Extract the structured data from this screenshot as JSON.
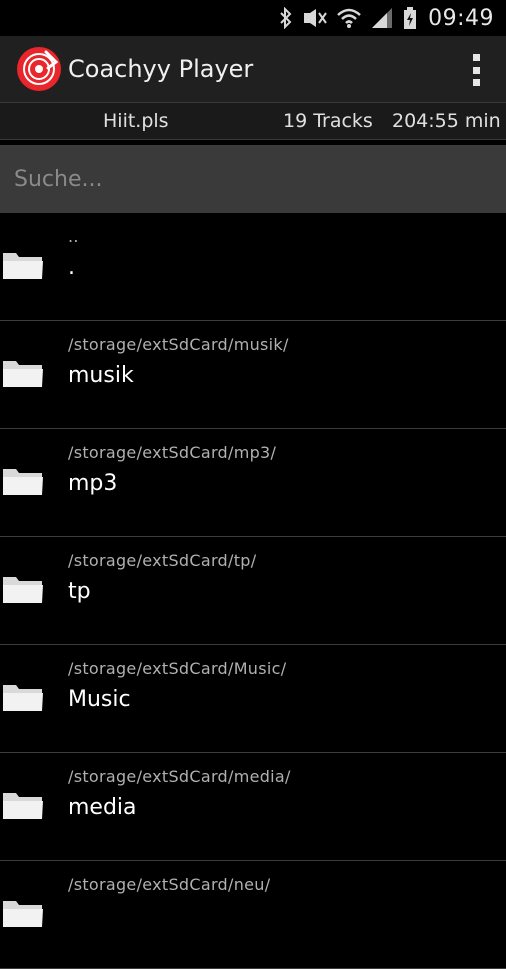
{
  "status_bar": {
    "time": "09:49",
    "icons": [
      "bluetooth-icon",
      "mute-icon",
      "wifi-icon",
      "signal-icon",
      "battery-icon"
    ]
  },
  "action_bar": {
    "title": "Coachyy Player",
    "logo": "vinyl-record-logo",
    "menu_icon": "overflow-menu-icon",
    "accent_color": "#e8262b"
  },
  "info_bar": {
    "playlist": "Hiit.pls",
    "tracks": "19 Tracks",
    "duration": "204:55 min"
  },
  "search": {
    "placeholder": "Suche..."
  },
  "list": {
    "items": [
      {
        "path": "..",
        "name": "."
      },
      {
        "path": "/storage/extSdCard/musik/",
        "name": "musik"
      },
      {
        "path": "/storage/extSdCard/mp3/",
        "name": "mp3"
      },
      {
        "path": "/storage/extSdCard/tp/",
        "name": "tp"
      },
      {
        "path": "/storage/extSdCard/Music/",
        "name": "Music"
      },
      {
        "path": "/storage/extSdCard/media/",
        "name": "media"
      },
      {
        "path": "/storage/extSdCard/neu/",
        "name": ""
      }
    ]
  }
}
